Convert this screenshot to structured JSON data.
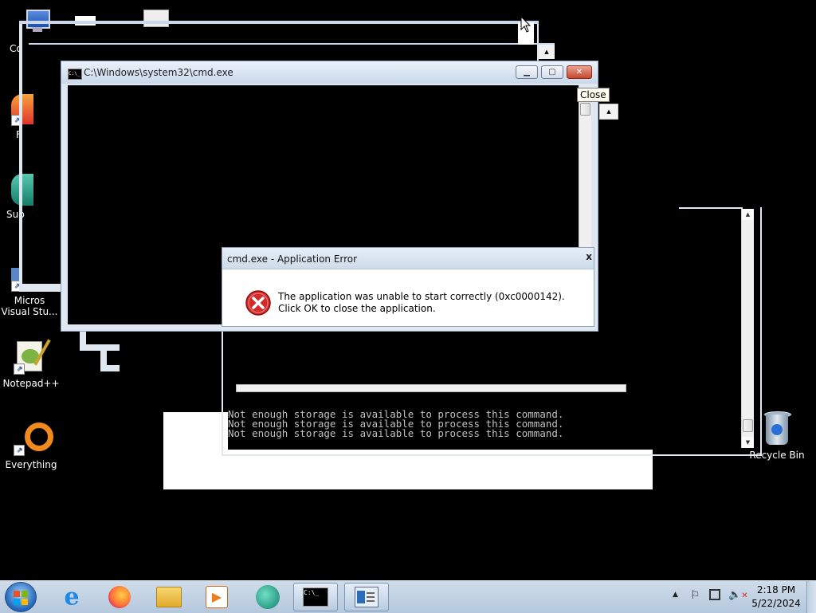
{
  "desktop": {
    "icons": [
      {
        "label": "Co",
        "icon": "computer-icon"
      },
      {
        "label": "F",
        "icon": "firefox-icon"
      },
      {
        "label": "Sup",
        "icon": "support-icon"
      },
      {
        "label": "Micros\nVisual Stu...",
        "icon": "visual-studio-icon"
      },
      {
        "label": "Notepad++",
        "icon": "notepad-plus-plus-icon"
      },
      {
        "label": "Everything",
        "icon": "everything-search-icon"
      },
      {
        "label": "Recycle Bin",
        "icon": "recycle-bin-icon"
      }
    ]
  },
  "cmd_window": {
    "title": "C:\\Windows\\system32\\cmd.exe",
    "tooltip": "Close",
    "icon": "cmd-icon"
  },
  "error_dialog": {
    "title": "cmd.exe - Application Error",
    "message": "The application was unable to start correctly (0xc0000142). Click OK to close the application.",
    "icon": "error-icon",
    "close_glyph": "x"
  },
  "background_console": {
    "lines": [
      "Not enough storage is available to process this command.",
      "Not enough storage is available to process this command.",
      "Not enough storage is available to process this command."
    ]
  },
  "taskbar": {
    "start_icon": "windows-start-icon",
    "pinned": [
      {
        "name": "internet-explorer-icon"
      },
      {
        "name": "firefox-icon"
      },
      {
        "name": "file-explorer-icon"
      },
      {
        "name": "media-player-icon"
      },
      {
        "name": "support-assistant-icon"
      },
      {
        "name": "cmd-taskbar-icon"
      },
      {
        "name": "window-taskbar-icon"
      }
    ],
    "clock": {
      "time": "2:18 PM",
      "date": "5/22/2024"
    },
    "tray_icons": [
      "show-hidden-icons-icon",
      "action-center-flag-icon",
      "network-icon",
      "volume-muted-icon"
    ]
  },
  "colors": {
    "desktop": "#000000",
    "close_button": "#c6452e",
    "error_red": "#d42a2a"
  }
}
